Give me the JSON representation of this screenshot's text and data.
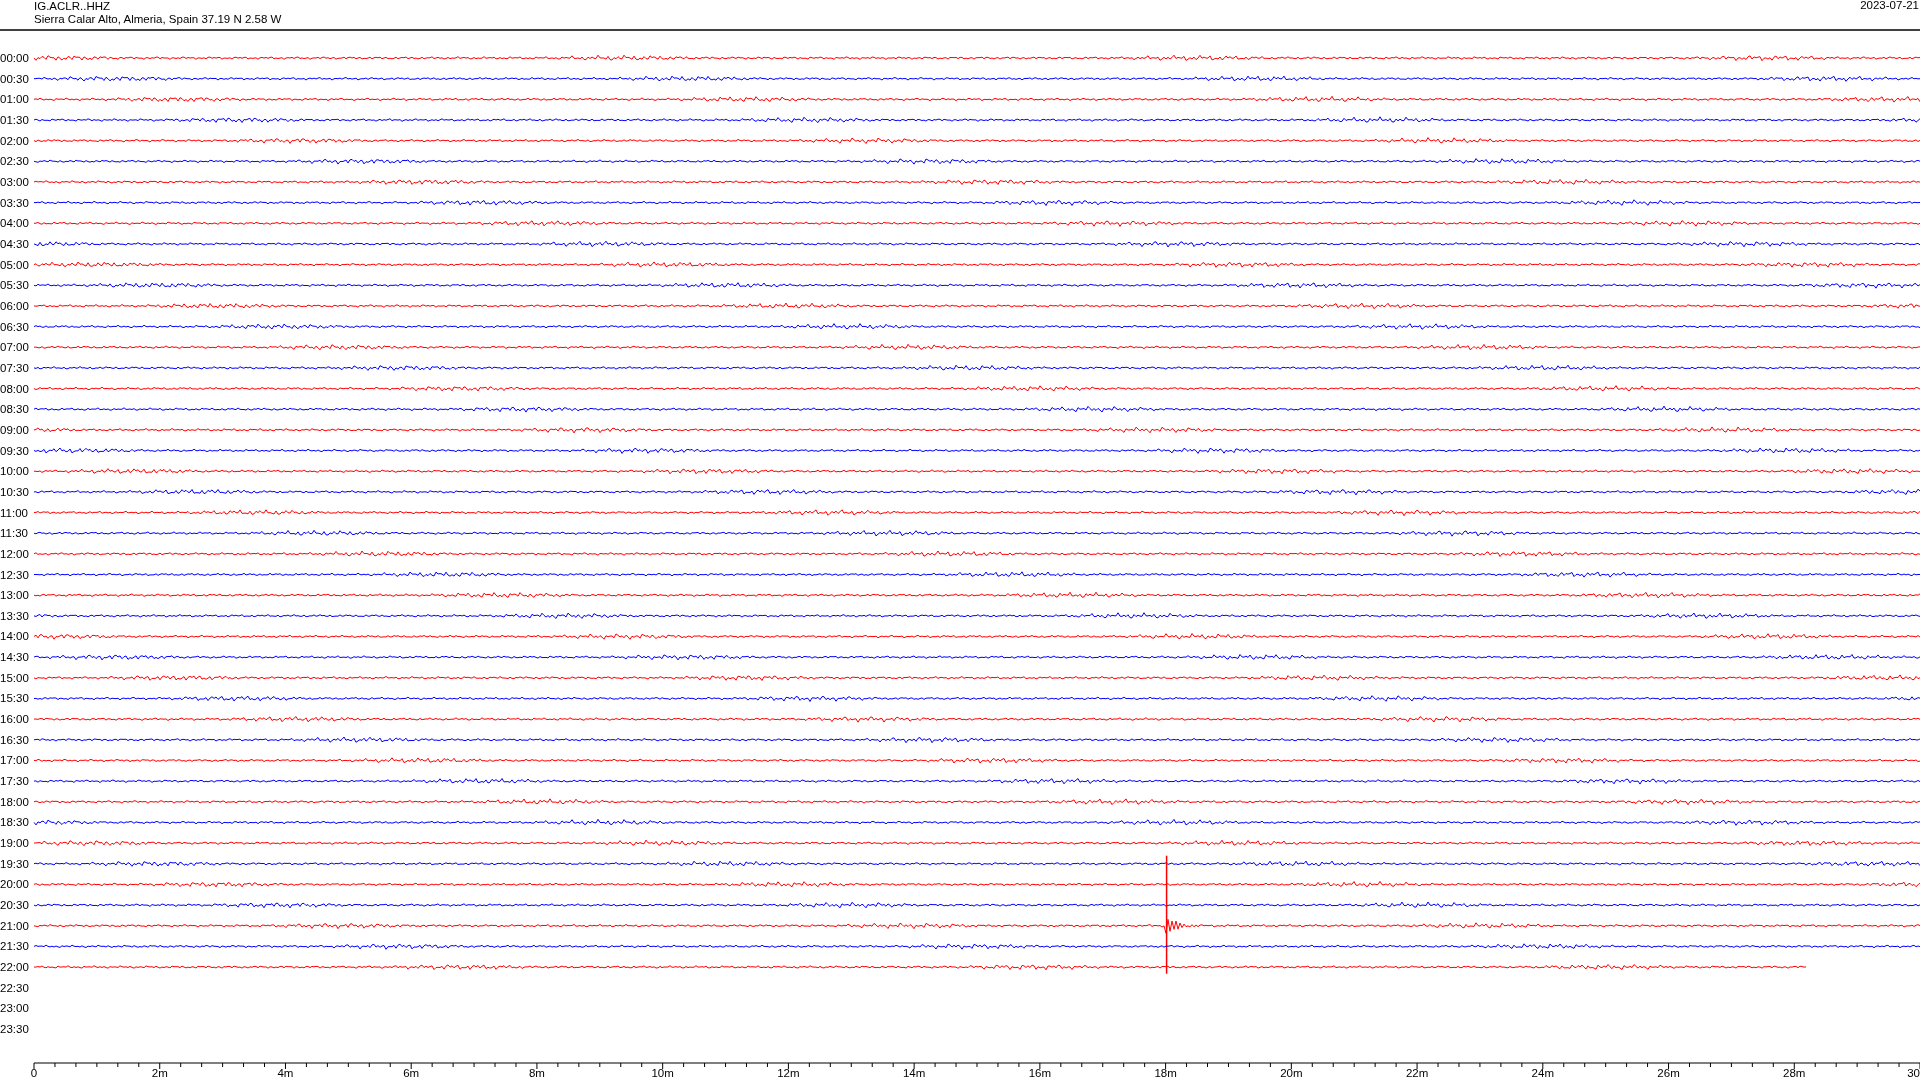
{
  "header": {
    "station": "IG.ACLR..HHZ",
    "location": "Sierra Calar Alto, Almeria, Spain  37.19 N 2.58 W",
    "date": "2023-07-21"
  },
  "rows": [
    {
      "time": "00:00",
      "kind": "full"
    },
    {
      "time": "00:30",
      "kind": "full"
    },
    {
      "time": "01:00",
      "kind": "full"
    },
    {
      "time": "01:30",
      "kind": "full"
    },
    {
      "time": "02:00",
      "kind": "full"
    },
    {
      "time": "02:30",
      "kind": "full"
    },
    {
      "time": "03:00",
      "kind": "full"
    },
    {
      "time": "03:30",
      "kind": "full"
    },
    {
      "time": "04:00",
      "kind": "full"
    },
    {
      "time": "04:30",
      "kind": "full"
    },
    {
      "time": "05:00",
      "kind": "full"
    },
    {
      "time": "05:30",
      "kind": "full"
    },
    {
      "time": "06:00",
      "kind": "full"
    },
    {
      "time": "06:30",
      "kind": "full"
    },
    {
      "time": "07:00",
      "kind": "full"
    },
    {
      "time": "07:30",
      "kind": "full"
    },
    {
      "time": "08:00",
      "kind": "full"
    },
    {
      "time": "08:30",
      "kind": "full"
    },
    {
      "time": "09:00",
      "kind": "full"
    },
    {
      "time": "09:30",
      "kind": "full"
    },
    {
      "time": "10:00",
      "kind": "full"
    },
    {
      "time": "10:30",
      "kind": "full"
    },
    {
      "time": "11:00",
      "kind": "full"
    },
    {
      "time": "11:30",
      "kind": "full"
    },
    {
      "time": "12:00",
      "kind": "full"
    },
    {
      "time": "12:30",
      "kind": "full"
    },
    {
      "time": "13:00",
      "kind": "full"
    },
    {
      "time": "13:30",
      "kind": "full"
    },
    {
      "time": "14:00",
      "kind": "full"
    },
    {
      "time": "14:30",
      "kind": "full"
    },
    {
      "time": "15:00",
      "kind": "full"
    },
    {
      "time": "15:30",
      "kind": "full"
    },
    {
      "time": "16:00",
      "kind": "full"
    },
    {
      "time": "16:30",
      "kind": "full"
    },
    {
      "time": "17:00",
      "kind": "full"
    },
    {
      "time": "17:30",
      "kind": "full"
    },
    {
      "time": "18:00",
      "kind": "full"
    },
    {
      "time": "18:30",
      "kind": "full"
    },
    {
      "time": "19:00",
      "kind": "full"
    },
    {
      "time": "19:30",
      "kind": "full"
    },
    {
      "time": "20:00",
      "kind": "full"
    },
    {
      "time": "20:30",
      "kind": "full"
    },
    {
      "time": "21:00",
      "kind": "event"
    },
    {
      "time": "21:30",
      "kind": "full"
    },
    {
      "time": "22:00",
      "kind": "partial"
    },
    {
      "time": "22:30",
      "kind": "none"
    },
    {
      "time": "23:00",
      "kind": "none"
    },
    {
      "time": "23:30",
      "kind": "none"
    }
  ],
  "axis_labels": [
    "0",
    "2m",
    "4m",
    "6m",
    "8m",
    "10m",
    "12m",
    "14m",
    "16m",
    "18m",
    "20m",
    "22m",
    "24m",
    "26m",
    "28m",
    "30"
  ]
}
